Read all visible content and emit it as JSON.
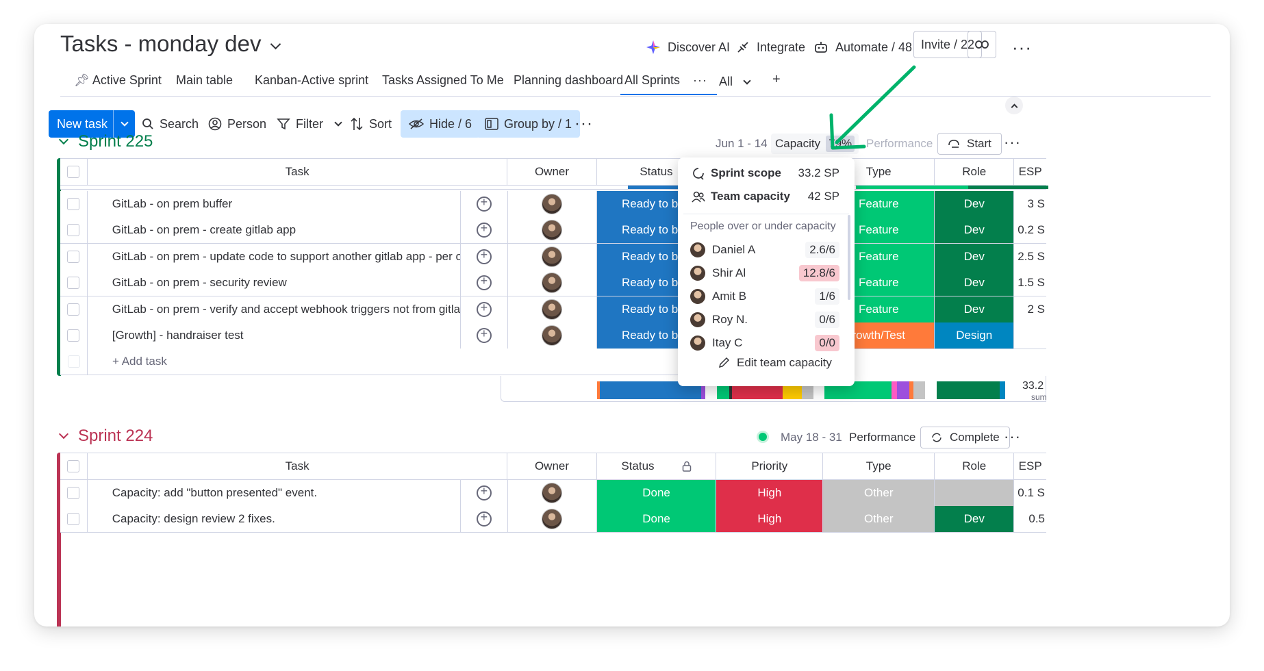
{
  "header": {
    "title": "Tasks - monday dev",
    "discover_ai": "Discover AI",
    "integrate": "Integrate",
    "automate": "Automate / 48",
    "invite": "Invite / 22"
  },
  "tabs": [
    "Active Sprint",
    "Main table",
    "Kanban-Active sprint",
    "Tasks Assigned To Me",
    "Planning dashboard",
    "All Sprints",
    "All",
    "+"
  ],
  "toolbar": {
    "new_task": "New task",
    "search": "Search",
    "person": "Person",
    "filter": "Filter",
    "sort": "Sort",
    "hide": "Hide / 6",
    "group_by": "Group by / 1"
  },
  "sprint225": {
    "title": "Sprint 225",
    "dates": "Jun 1 - 14",
    "capacity_label": "Capacity",
    "capacity_value": "79%",
    "performance": "Performance",
    "start": "Start",
    "columns": [
      "Task",
      "Owner",
      "Status",
      "Type",
      "Role",
      "ESP"
    ],
    "rows": [
      {
        "task": "GitLab - on prem buffer",
        "status": "Ready to beg",
        "type": "Feature",
        "role": "Dev",
        "esp": "3 S"
      },
      {
        "task": "GitLab - on prem - create gitlab app",
        "status": "Ready to beg",
        "type": "Feature",
        "role": "Dev",
        "esp": "0.2 S"
      },
      {
        "task": "GitLab - on prem - update code to support another gitlab app - per on pr...",
        "status": "Ready to beg",
        "type": "Feature",
        "role": "Dev",
        "esp": "2.5 S"
      },
      {
        "task": "GitLab - on prem - security review",
        "status": "Ready to beg",
        "type": "Feature",
        "role": "Dev",
        "esp": "1.5 S"
      },
      {
        "task": "GitLab - on prem - verify and accept webhook triggers not from gitlab.com",
        "status": "Ready to beg",
        "type": "Feature",
        "role": "Dev",
        "esp": "2 S"
      },
      {
        "task": "[Growth] - handraiser test",
        "status": "Ready to beg",
        "type": "rowth/Test",
        "role": "Design",
        "esp": ""
      }
    ],
    "add_task": "+ Add task",
    "sum_value": "33.2",
    "sum_label": "sum"
  },
  "capacity_popup": {
    "sprint_scope_label": "Sprint scope",
    "sprint_scope_value": "33.2 SP",
    "team_capacity_label": "Team capacity",
    "team_capacity_value": "42 SP",
    "section_title": "People over or under capacity",
    "people": [
      {
        "name": "Daniel A",
        "value": "2.6/6",
        "highlight": false
      },
      {
        "name": "Shir Al",
        "value": "12.8/6",
        "highlight": true
      },
      {
        "name": "Amit B",
        "value": "1/6",
        "highlight": false
      },
      {
        "name": "Roy N.",
        "value": "0/6",
        "highlight": false
      },
      {
        "name": "Itay C",
        "value": "0/0",
        "highlight": true
      }
    ],
    "edit_label": "Edit team capacity"
  },
  "sprint224": {
    "title": "Sprint 224",
    "dates": "May 18 - 31",
    "performance": "Performance",
    "complete": "Complete",
    "columns": [
      "Task",
      "Owner",
      "Status",
      "Priority",
      "Type",
      "Role",
      "ESP"
    ],
    "rows": [
      {
        "task": "Capacity: add \"button presented\" event.",
        "status": "Done",
        "priority": "High",
        "type": "Other",
        "role": "",
        "esp": "0.1 S"
      },
      {
        "task": "Capacity: design review 2 fixes.",
        "status": "Done",
        "priority": "High",
        "type": "Other",
        "role": "Dev",
        "esp": "0.5"
      }
    ]
  },
  "colors": {
    "accent": "#0073ea",
    "sprint225": "#037f4c",
    "sprint224": "#bb3354",
    "status_blue": "#1f76c2",
    "feature_green": "#00c875",
    "dev_green": "#037f4c",
    "growth_orange": "#ff7a3a",
    "design_blue": "#0086c0",
    "done_green": "#00c875",
    "high_red": "#df2f4a",
    "other_gray": "#c4c4c4",
    "arrow_green": "#00b36b"
  }
}
